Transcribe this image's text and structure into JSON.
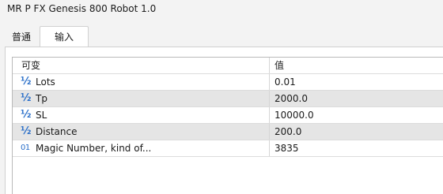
{
  "window": {
    "title": "MR P FX Genesis 800 Robot 1.0"
  },
  "tabs": [
    {
      "label": "普通",
      "active": false
    },
    {
      "label": "输入",
      "active": true
    }
  ],
  "grid": {
    "headers": {
      "variable": "可变",
      "value": "值"
    },
    "rows": [
      {
        "icon": "fraction-half-icon",
        "icon_glyph": "½",
        "name": "Lots",
        "value": "0.01"
      },
      {
        "icon": "fraction-half-icon",
        "icon_glyph": "½",
        "name": "Tp",
        "value": "2000.0"
      },
      {
        "icon": "fraction-half-icon",
        "icon_glyph": "½",
        "name": "SL",
        "value": "10000.0"
      },
      {
        "icon": "fraction-half-icon",
        "icon_glyph": "½",
        "name": "Distance",
        "value": "200.0"
      },
      {
        "icon": "integer-01-icon",
        "icon_glyph": "01",
        "name": "Magic Number, kind of...",
        "value": "3835"
      }
    ]
  },
  "colors": {
    "icon": "#2a6fc9",
    "shaded_row": "#e5e5e5"
  }
}
